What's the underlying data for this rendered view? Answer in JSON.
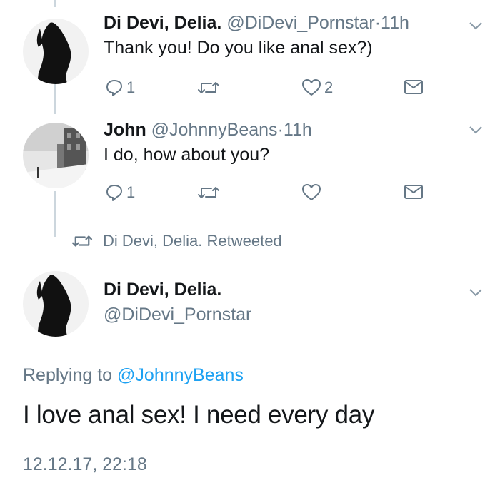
{
  "tweets": [
    {
      "name": "Di Devi, Delia.",
      "handle": "@DiDevi_Pornstar",
      "dot": "·",
      "time": "11h",
      "text": "Thank you! Do you like anal sex?)",
      "reply_count": "1",
      "like_count": "2",
      "avatar_icon": "silhouette-avatar"
    },
    {
      "name": "John",
      "handle": "@JohnnyBeans",
      "dot": "·",
      "time": "11h",
      "text": "I do, how about you?",
      "reply_count": "1",
      "like_count": "",
      "avatar_icon": "winter-street-avatar"
    }
  ],
  "retweet_label": "Di Devi, Delia. Retweeted",
  "main_tweet": {
    "name": "Di Devi, Delia.",
    "handle": "@DiDevi_Pornstar",
    "replying_prefix": "Replying to",
    "replying_handle": "@JohnnyBeans",
    "text": "I love anal sex! I need every day",
    "timestamp": "12.12.17, 22:18"
  },
  "colors": {
    "text": "#14171a",
    "secondary": "#657786",
    "accent": "#1da1f2",
    "thread_line": "#ccd6dd"
  }
}
